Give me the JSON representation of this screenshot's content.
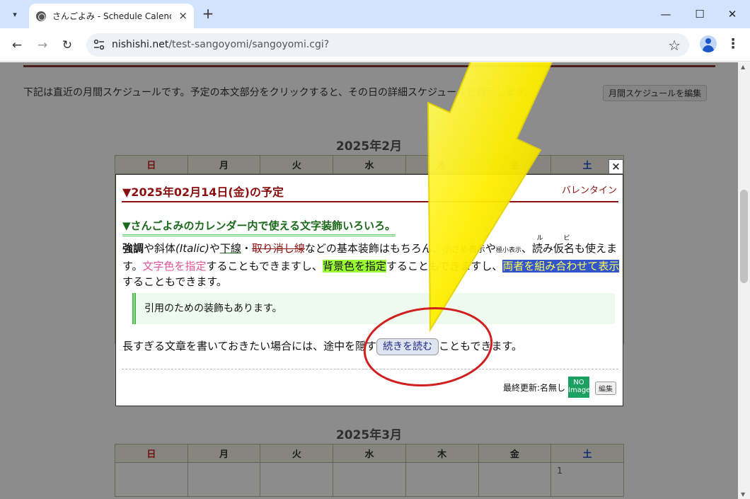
{
  "browser": {
    "tab_title": "さんごよみ - Schedule Calendar -",
    "url_host": "nishishi.net",
    "url_path": "/test-sangoyomi/sangoyomi.cgi?"
  },
  "page": {
    "intro_text": "下記は直近の月間スケジュールです。予定の本文部分をクリックすると、その日の詳細スケジュールを表示します。",
    "edit_monthly_label": "月間スケジュールを編集",
    "month1_title": "2025年2月",
    "month2_title": "2025年3月",
    "weekdays": [
      "日",
      "月",
      "火",
      "水",
      "木",
      "金",
      "土"
    ],
    "march_first_day": "1"
  },
  "popup": {
    "title": "▼2025年02月14日(金)の予定",
    "tag": "バレンタイン",
    "section_heading": "▼さんごよみのカレンダー内で使える文字装飾いろいろ。",
    "t1_strong": "強調",
    "t2": "や斜体",
    "t3_italic": "(Italic)",
    "t4": "や",
    "t5_under": "下線",
    "t6": "・",
    "t7_strike": "取り消し線",
    "t8": "などの基本装飾はもちろん、",
    "t9_small": "小さめ表示",
    "t10": "や",
    "t11_tiny": "極小表示",
    "t12": "、",
    "t13_ruby_base": "読み仮名",
    "t13_ruby_text": "ル ビ",
    "t14": "も使えます。",
    "t15_pink": "文字色を指定",
    "t16": "することもできますし、",
    "t17_bg": "背景色を指定",
    "t18": "することもできますし、",
    "t19_combo": "両者を組み合わせて表示",
    "t20": "することもできます。",
    "quote": "引用のための装飾もあります。",
    "last_before": "長すぎる文章を書いておきたい場合には、途中を隠す",
    "more_label": "続きを読む",
    "last_after": "こともできます。",
    "updated": "最終更新:名無し",
    "noimage_line1": "NO",
    "noimage_line2": "Image",
    "edit_label": "編集",
    "close_label": "×"
  },
  "colors": {
    "accent": "#8b1010",
    "heading_green": "#1a6a1a",
    "bg_highlight": "#99ff33",
    "combo_bg": "#3355cc",
    "combo_fg": "#ffff55",
    "pink": "#e0559a",
    "arrow_yellow": "#ffee00",
    "circle_red": "#d02020"
  }
}
